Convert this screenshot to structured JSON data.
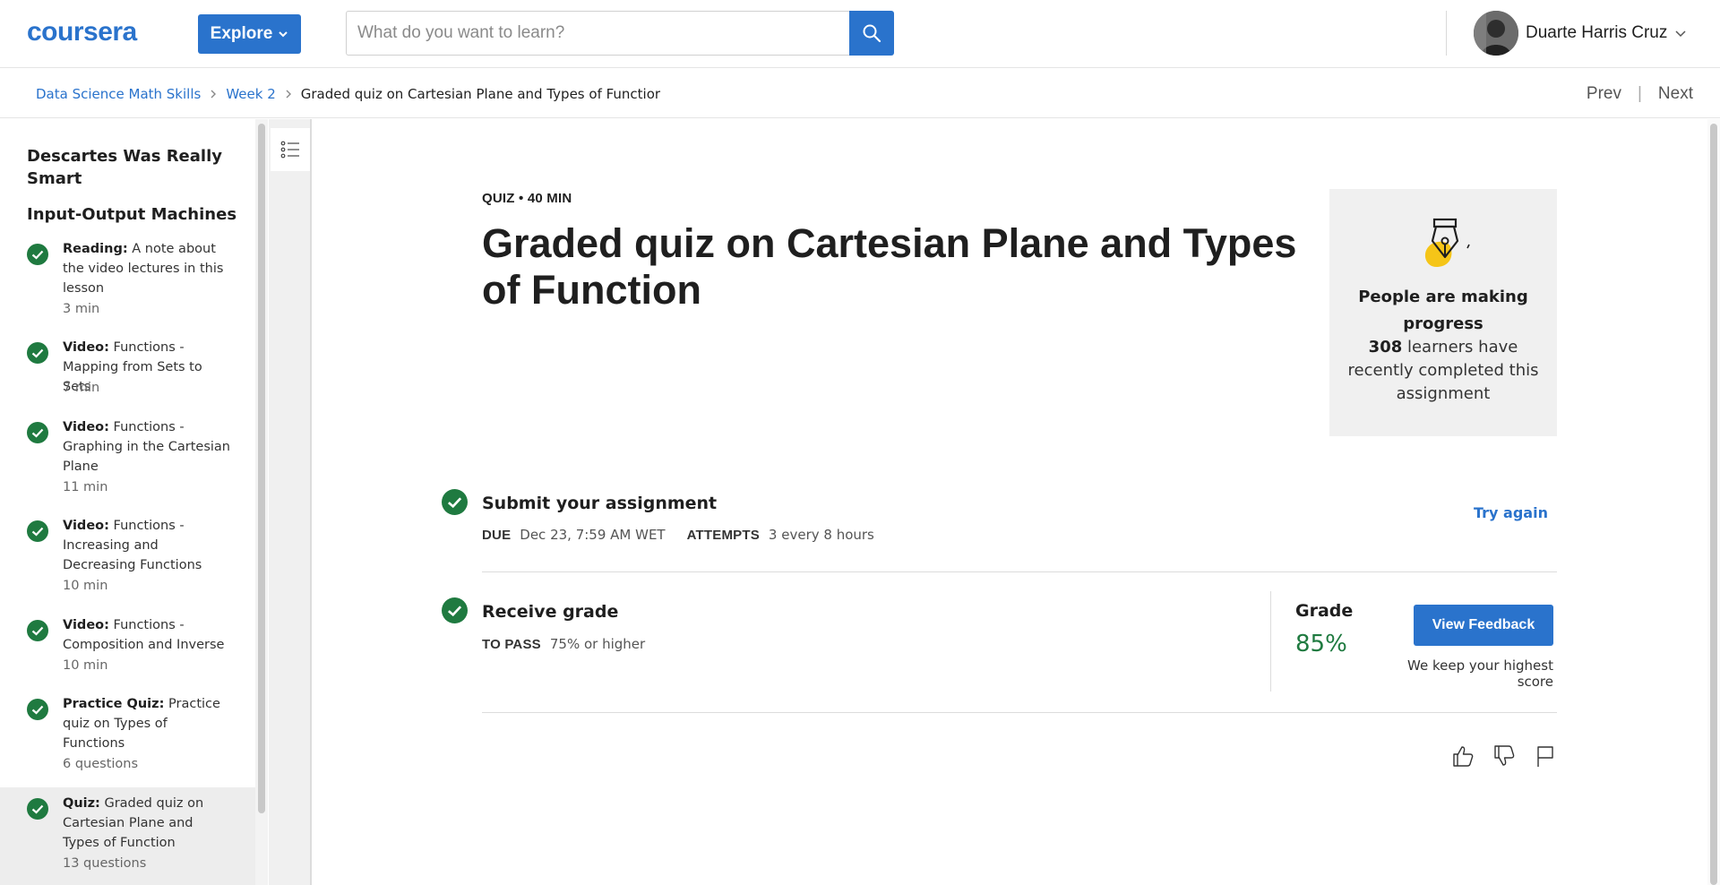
{
  "header": {
    "logo_text": "coursera",
    "explore_label": "Explore",
    "search_placeholder": "What do you want to learn?",
    "user_name": "Duarte Harris Cruz"
  },
  "breadcrumb": {
    "items": [
      "Data Science Math Skills",
      "Week 2"
    ],
    "current": "Graded quiz on Cartesian Plane and Types of Functior"
  },
  "nav": {
    "prev": "Prev",
    "next": "Next"
  },
  "sidebar": {
    "module_title": "Descartes Was Really Smart",
    "lesson_title": "Input-Output Machines",
    "items": [
      {
        "type": "Reading:",
        "title": "A note about the video lectures in this lesson",
        "meta": "3 min"
      },
      {
        "type": "Video:",
        "title": "Functions - Mapping from Sets to Sets",
        "meta": "7 min"
      },
      {
        "type": "Video:",
        "title": "Functions - Graphing in the Cartesian Plane",
        "meta": "11 min"
      },
      {
        "type": "Video:",
        "title": "Functions - Increasing and Decreasing Functions",
        "meta": "10 min"
      },
      {
        "type": "Video:",
        "title": "Functions - Composition and Inverse",
        "meta": "10 min"
      },
      {
        "type": "Practice Quiz:",
        "title": "Practice quiz on Types of Functions",
        "meta": "6 questions"
      },
      {
        "type": "Quiz:",
        "title": "Graded quiz on Cartesian Plane and Types of Function",
        "meta": "13 questions"
      }
    ]
  },
  "main": {
    "eyebrow": "QUIZ • 40 MIN",
    "title": "Graded quiz on Cartesian Plane and Types of Function",
    "progress_card": {
      "title": "People are making progress",
      "count": "308",
      "body": "learners have recently completed this assignment"
    },
    "submit": {
      "title": "Submit your assignment",
      "due_label": "DUE",
      "due_value": "Dec 23, 7:59 AM WET",
      "attempts_label": "ATTEMPTS",
      "attempts_value": "3 every 8 hours",
      "try_again": "Try again"
    },
    "receive": {
      "title": "Receive grade",
      "to_pass_label": "TO PASS",
      "to_pass_value": "75% or higher",
      "grade_label": "Grade",
      "grade_value": "85%",
      "view_feedback": "View Feedback",
      "keep_note": "We keep your highest score"
    }
  },
  "colors": {
    "brand_blue": "#2a73cc",
    "success_green": "#1f7a40",
    "card_bg": "#f0f0f0"
  },
  "icons": {
    "search": "search-icon",
    "explore_chevron": "chevron-down-icon",
    "user_chevron": "chevron-down-icon",
    "breadcrumb_sep": "chevron-right-icon",
    "check": "check-circle-icon",
    "outline_toggle": "list-icon",
    "progress": "pen-nib-icon",
    "like": "thumbs-up-icon",
    "dislike": "thumbs-down-icon",
    "flag": "flag-icon"
  }
}
